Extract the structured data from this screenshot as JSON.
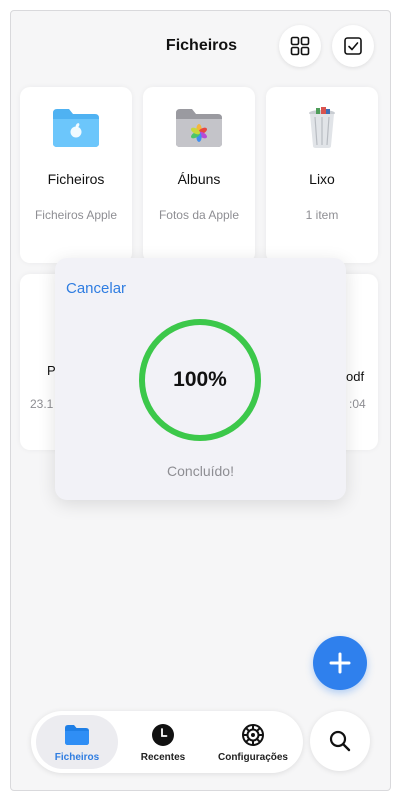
{
  "header": {
    "title": "Ficheiros"
  },
  "cards": [
    {
      "name": "Ficheiros",
      "sub": "Ficheiros Apple",
      "icon": "folder-apple-icon"
    },
    {
      "name": "Álbuns",
      "sub": "Fotos da Apple",
      "icon": "photos-folder-icon"
    },
    {
      "name": "Lixo",
      "sub": "1 item",
      "icon": "trash-bin-icon"
    }
  ],
  "hidden_cards": {
    "left_name_fragment": "P",
    "left_date_fragment": "23.1",
    "right_name_fragment": "odf",
    "right_date_fragment": ":04"
  },
  "progress": {
    "cancel_label": "Cancelar",
    "percent_text": "100%",
    "percent_value": 100,
    "status": "Concluído!",
    "color": "#3cc84a"
  },
  "tabs": [
    {
      "label": "Ficheiros",
      "icon": "folder-icon",
      "active": true
    },
    {
      "label": "Recentes",
      "icon": "clock-icon",
      "active": false
    },
    {
      "label": "Configurações",
      "icon": "gear-icon",
      "active": false
    }
  ],
  "colors": {
    "accent": "#2f7de1",
    "fab": "#2f80ed",
    "progress": "#3cc84a"
  }
}
